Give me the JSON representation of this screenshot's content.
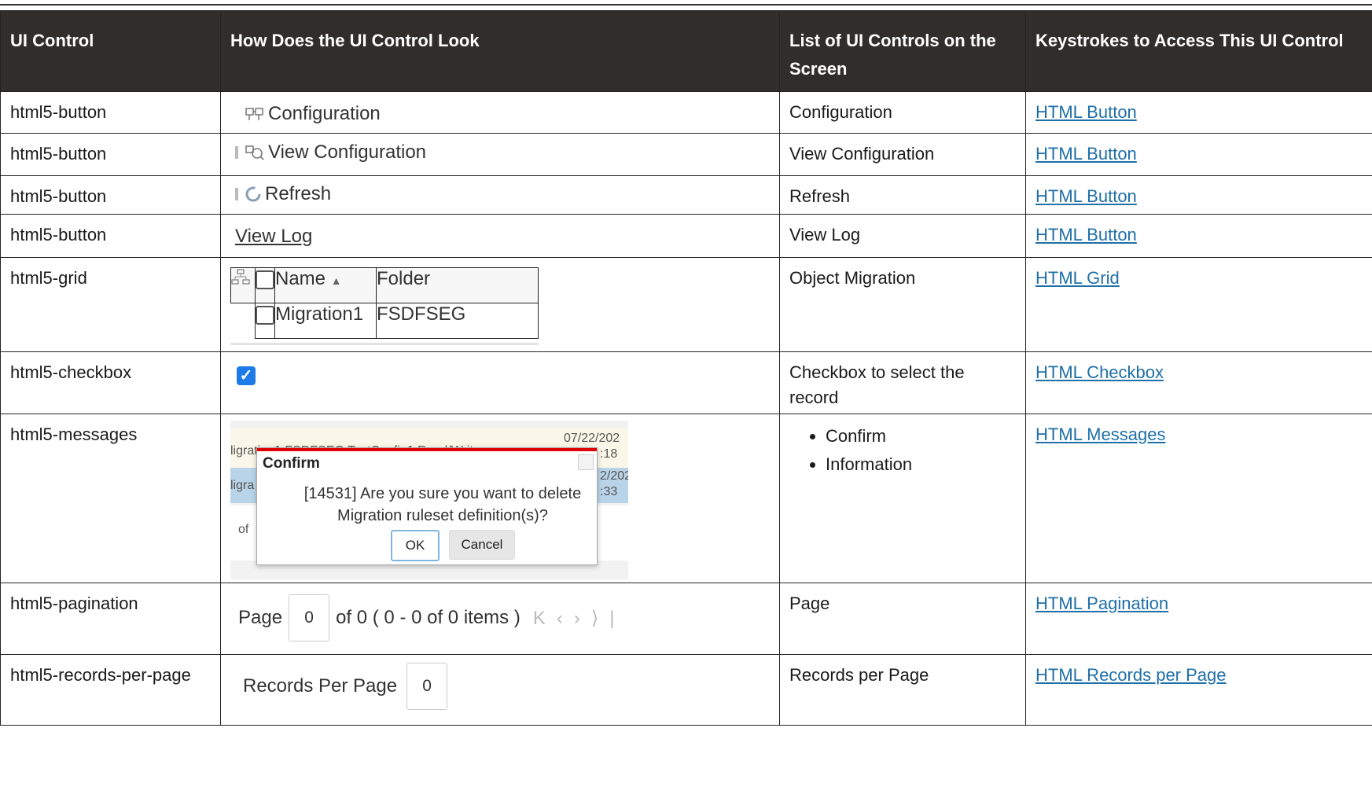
{
  "headers": {
    "col1": "UI Control",
    "col2": "How Does the UI Control Look",
    "col3": "List of UI Controls on the Screen",
    "col4": "Keystrokes to Access This UI Control"
  },
  "rows": [
    {
      "control": "html5-button",
      "sample_label": "Configuration",
      "list": "Configuration",
      "link": "HTML Button"
    },
    {
      "control": "html5-button",
      "sample_label": "View Configuration",
      "list": "View Configuration",
      "link": "HTML Button"
    },
    {
      "control": "html5-button",
      "sample_label": "Refresh",
      "list": "Refresh",
      "link": "HTML Button"
    },
    {
      "control": "html5-button",
      "sample_label": "View Log",
      "list": "View Log",
      "link": "HTML Button"
    },
    {
      "control": "html5-grid",
      "list": "Object Migration",
      "link": "HTML Grid",
      "grid": {
        "col_name": "Name",
        "col_folder": "Folder",
        "row_name": "Migration1",
        "row_folder": "FSDFSEG"
      }
    },
    {
      "control": "html5-checkbox",
      "list": "Checkbox to select the record",
      "link": "HTML Checkbox"
    },
    {
      "control": "html5-messages",
      "list_items": [
        "Confirm",
        "Information"
      ],
      "link": "HTML Messages",
      "dialog": {
        "title": "Confirm",
        "message": "[14531] Are you sure you want to delete Migration ruleset definition(s)?",
        "ok": "OK",
        "cancel": "Cancel",
        "bg_row1": "ligration1   FSDFSEG   TextConfig1           Read/Write",
        "bg_date1": "07/22/202",
        "bg_time1": ":18",
        "bg_date2": "2/202",
        "bg_time2": ":33",
        "bg_mig2": "ligra",
        "bg_of": "of"
      }
    },
    {
      "control": "html5-pagination",
      "list": "Page",
      "link": "HTML Pagination",
      "pager": {
        "page_label": "Page",
        "page_value": "0",
        "summary": "of 0 ( 0 - 0 of 0 items )"
      }
    },
    {
      "control": "html5-records-per-page",
      "list": "Records per Page",
      "link": "HTML Records per Page",
      "rpp": {
        "label": "Records Per Page",
        "value": "0"
      }
    }
  ]
}
